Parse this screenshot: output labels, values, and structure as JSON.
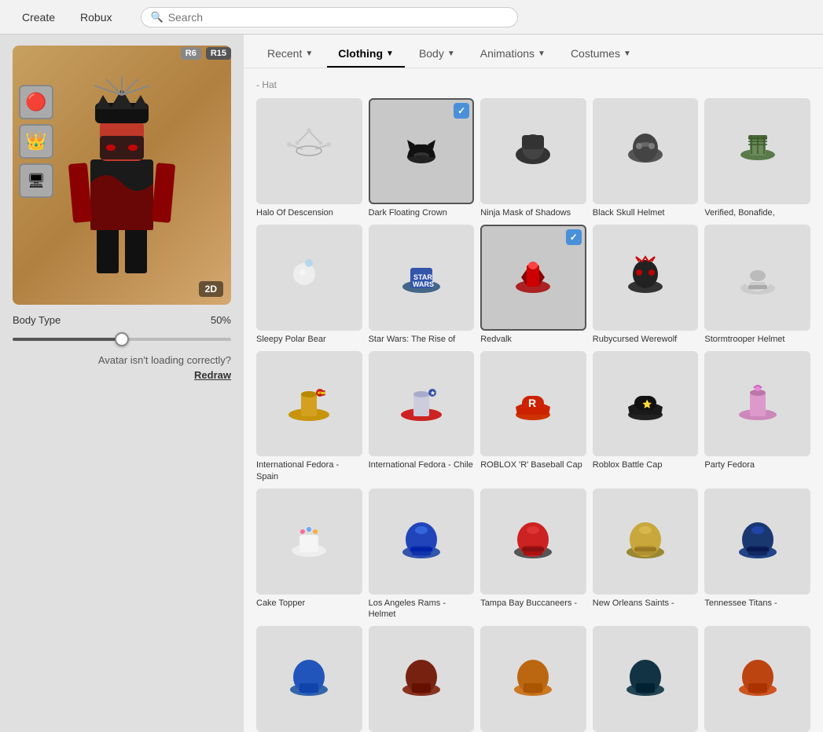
{
  "topbar": {
    "create_label": "Create",
    "robux_label": "Robux",
    "search_placeholder": "Search"
  },
  "left_panel": {
    "r6_badge": "R6",
    "r15_badge": "R15",
    "btn_2d": "2D",
    "body_type_label": "Body Type",
    "body_type_value": "50%",
    "body_type_percent": 50,
    "avatar_warning": "Avatar isn't loading correctly?",
    "redraw_label": "Redraw"
  },
  "tabs": [
    {
      "id": "recent",
      "label": "Recent",
      "active": false
    },
    {
      "id": "clothing",
      "label": "Clothing",
      "active": true
    },
    {
      "id": "body",
      "label": "Body",
      "active": false
    },
    {
      "id": "animations",
      "label": "Animations",
      "active": false
    },
    {
      "id": "costumes",
      "label": "Costumes",
      "active": false
    }
  ],
  "section_label": "- Hat",
  "items": [
    {
      "id": 1,
      "label": "Halo Of Descension",
      "thumb_class": "thumb-halo",
      "icon": "✨",
      "selected": false,
      "check": false
    },
    {
      "id": 2,
      "label": "Dark Floating Crown",
      "thumb_class": "thumb-crown-dark",
      "icon": "👑",
      "selected": true,
      "check": true
    },
    {
      "id": 3,
      "label": "Ninja Mask of Shadows",
      "thumb_class": "thumb-ninja",
      "icon": "🎭",
      "selected": false,
      "check": false
    },
    {
      "id": 4,
      "label": "Black Skull Helmet",
      "thumb_class": "thumb-skull",
      "icon": "💀",
      "selected": false,
      "check": false
    },
    {
      "id": 5,
      "label": "Verified, Bonafide,",
      "thumb_class": "thumb-plaid",
      "icon": "🧢",
      "selected": false,
      "check": false
    },
    {
      "id": 6,
      "label": "Sleepy Polar Bear",
      "thumb_class": "thumb-polar-bear",
      "icon": "🐻",
      "selected": false,
      "check": false
    },
    {
      "id": 7,
      "label": "Star Wars: The Rise of",
      "thumb_class": "thumb-starwars",
      "icon": "⭐",
      "selected": false,
      "check": false
    },
    {
      "id": 8,
      "label": "Redvalk",
      "thumb_class": "thumb-redvalk",
      "icon": "🔴",
      "selected": true,
      "check": true
    },
    {
      "id": 9,
      "label": "Rubycursed Werewolf",
      "thumb_class": "thumb-werewolf",
      "icon": "🐺",
      "selected": false,
      "check": false
    },
    {
      "id": 10,
      "label": "Stormtrooper Helmet",
      "thumb_class": "thumb-trooper",
      "icon": "🪖",
      "selected": false,
      "check": false
    },
    {
      "id": 11,
      "label": "International Fedora - Spain",
      "thumb_class": "thumb-spain",
      "icon": "🪄",
      "selected": false,
      "check": false
    },
    {
      "id": 12,
      "label": "International Fedora - Chile",
      "thumb_class": "thumb-chile",
      "icon": "🎩",
      "selected": false,
      "check": false
    },
    {
      "id": 13,
      "label": "ROBLOX 'R' Baseball Cap",
      "thumb_class": "thumb-roblox-r",
      "icon": "🧢",
      "selected": false,
      "check": false
    },
    {
      "id": 14,
      "label": "Roblox Battle Cap",
      "thumb_class": "thumb-battle-cap",
      "icon": "🎓",
      "selected": false,
      "check": false
    },
    {
      "id": 15,
      "label": "Party Fedora",
      "thumb_class": "thumb-party",
      "icon": "🎉",
      "selected": false,
      "check": false
    },
    {
      "id": 16,
      "label": "Cake Topper",
      "thumb_class": "thumb-cake",
      "icon": "🎂",
      "selected": false,
      "check": false
    },
    {
      "id": 17,
      "label": "Los Angeles Rams - Helmet",
      "thumb_class": "thumb-rams",
      "icon": "🏈",
      "selected": false,
      "check": false
    },
    {
      "id": 18,
      "label": "Tampa Bay Buccaneers -",
      "thumb_class": "thumb-buccaneers",
      "icon": "🏈",
      "selected": false,
      "check": false
    },
    {
      "id": 19,
      "label": "New Orleans Saints -",
      "thumb_class": "thumb-saints",
      "icon": "🏈",
      "selected": false,
      "check": false
    },
    {
      "id": 20,
      "label": "Tennessee Titans -",
      "thumb_class": "thumb-titans",
      "icon": "🏈",
      "selected": false,
      "check": false
    },
    {
      "id": 21,
      "label": "",
      "thumb_class": "thumb-bottom1",
      "icon": "🏈",
      "selected": false,
      "check": false
    },
    {
      "id": 22,
      "label": "",
      "thumb_class": "thumb-bottom2",
      "icon": "🏈",
      "selected": false,
      "check": false
    },
    {
      "id": 23,
      "label": "",
      "thumb_class": "thumb-bottom3",
      "icon": "🏈",
      "selected": false,
      "check": false
    },
    {
      "id": 24,
      "label": "",
      "thumb_class": "thumb-bottom4",
      "icon": "🏈",
      "selected": false,
      "check": false
    },
    {
      "id": 25,
      "label": "",
      "thumb_class": "thumb-bottom5",
      "icon": "🏈",
      "selected": false,
      "check": false
    }
  ]
}
